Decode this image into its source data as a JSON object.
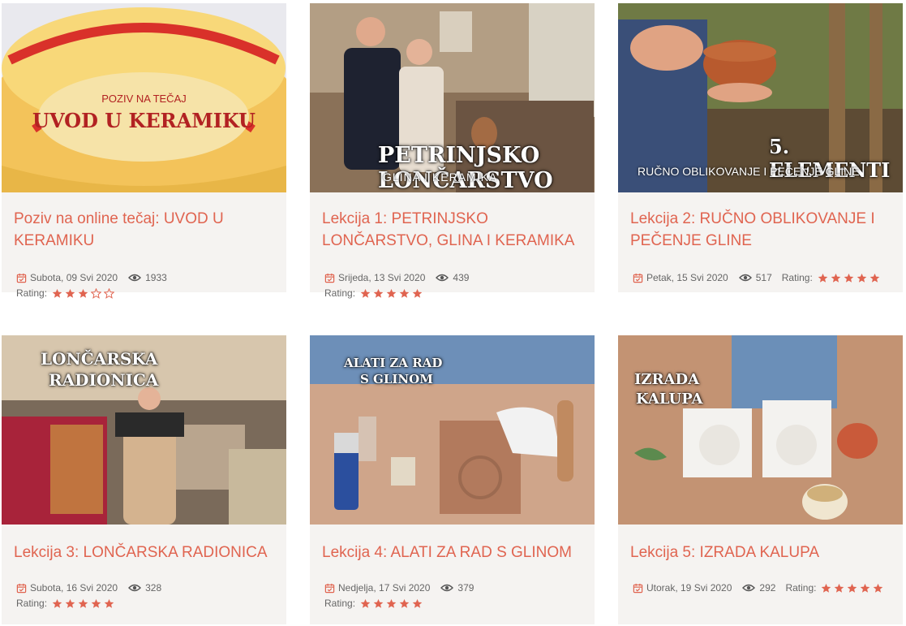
{
  "colors": {
    "accent": "#e06450",
    "card_bg": "#f5f3f1",
    "meta_text": "#666666"
  },
  "meta_labels": {
    "rating": "Rating:"
  },
  "cards": [
    {
      "title": "Poziv na online tečaj: UVOD U KERAMIKU",
      "date": "Subota, 09 Svi 2020",
      "views": "1933",
      "rating": 3,
      "overlay": [
        "POZIV NA TEČAJ",
        "UVOD U KERAMIKU"
      ]
    },
    {
      "title": "Lekcija 1: PETRINJSKO LONČARSTVO, GLINA I KERAMIKA",
      "date": "Srijeda, 13 Svi 2020",
      "views": "439",
      "rating": 5,
      "overlay": [
        "PETRINJSKO LONČARSTVO",
        "GLINA I KERAMIKA"
      ]
    },
    {
      "title": "Lekcija 2: RUČNO OBLIKOVANJE I PEČENJE GLINE",
      "date": "Petak, 15 Svi 2020",
      "views": "517",
      "rating": 5,
      "overlay": [
        "5. ELEMENTI",
        "RUČNO OBLIKOVANJE I PEČENJE GLINE"
      ]
    },
    {
      "title": "Lekcija 3: LONČARSKA RADIONICA",
      "date": "Subota, 16 Svi 2020",
      "views": "328",
      "rating": 5,
      "overlay": [
        "LONČARSKA",
        "RADIONICA"
      ]
    },
    {
      "title": "Lekcija 4: ALATI ZA RAD S GLINOM",
      "date": "Nedjelja, 17 Svi 2020",
      "views": "379",
      "rating": 5,
      "overlay": [
        "ALATI ZA RAD",
        "S GLINOM"
      ]
    },
    {
      "title": "Lekcija 5: IZRADA KALUPA",
      "date": "Utorak, 19 Svi 2020",
      "views": "292",
      "rating": 5,
      "overlay": [
        "IZRADA",
        "KALUPA"
      ]
    }
  ]
}
